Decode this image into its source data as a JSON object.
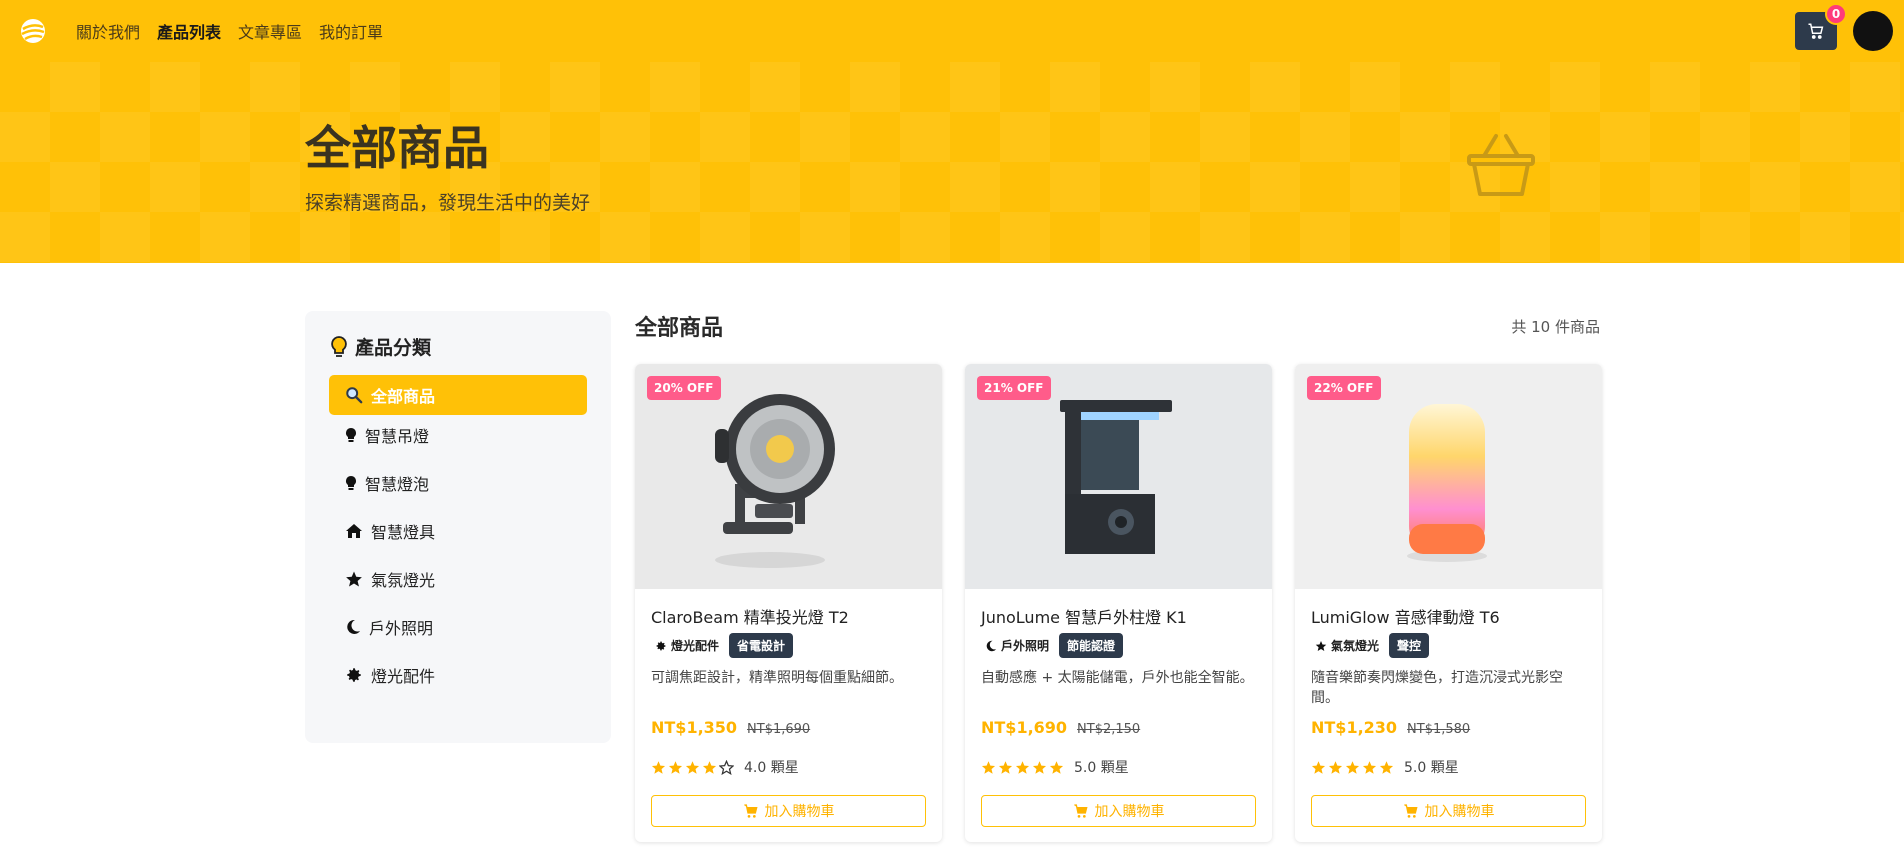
{
  "nav": {
    "links": [
      "關於我們",
      "產品列表",
      "文章專區",
      "我的訂單"
    ],
    "active_index": 1,
    "cart_count": "0"
  },
  "hero": {
    "title": "全部商品",
    "subtitle": "探索精選商品，發現生活中的美好",
    "icon": "basket-icon"
  },
  "sidebar": {
    "title": "產品分類",
    "title_icon": "lightbulb-icon",
    "items": [
      {
        "label": "全部商品",
        "icon": "search-icon",
        "active": true
      },
      {
        "label": "智慧吊燈",
        "icon": "bulb-icon"
      },
      {
        "label": "智慧燈泡",
        "icon": "bulb-icon"
      },
      {
        "label": "智慧燈具",
        "icon": "home-icon"
      },
      {
        "label": "氣氛燈光",
        "icon": "star-icon"
      },
      {
        "label": "戶外照明",
        "icon": "moon-icon"
      },
      {
        "label": "燈光配件",
        "icon": "gear-icon"
      }
    ]
  },
  "content": {
    "title": "全部商品",
    "count_text": "共 10 件商品"
  },
  "products": [
    {
      "discount": "20% OFF",
      "name": "ClaroBeam 精準投光燈 T2",
      "category": "燈光配件",
      "category_icon": "gear-icon",
      "tag": "省電設計",
      "desc": "可調焦距設計，精準照明每個重點細節。",
      "price": "NT$1,350",
      "orig_price": "NT$1,690",
      "rating": 4,
      "rating_text": "4.0 顆星",
      "button": "加入購物車"
    },
    {
      "discount": "21% OFF",
      "name": "JunoLume 智慧戶外柱燈 K1",
      "category": "戶外照明",
      "category_icon": "moon-icon",
      "tag": "節能認證",
      "desc": "自動感應 + 太陽能儲電，戶外也能全智能。",
      "price": "NT$1,690",
      "orig_price": "NT$2,150",
      "rating": 5,
      "rating_text": "5.0 顆星",
      "button": "加入購物車"
    },
    {
      "discount": "22% OFF",
      "name": "LumiGlow 音感律動燈 T6",
      "category": "氣氛燈光",
      "category_icon": "star-icon",
      "tag": "聲控",
      "desc": "隨音樂節奏閃爍變色，打造沉浸式光影空間。",
      "price": "NT$1,230",
      "orig_price": "NT$1,580",
      "rating": 5,
      "rating_text": "5.0 顆星",
      "button": "加入購物車"
    }
  ],
  "colors": {
    "accent": "#ffc107",
    "price": "#ffb300",
    "dark": "#2d3a4b",
    "discount": "#ff5c8a"
  }
}
